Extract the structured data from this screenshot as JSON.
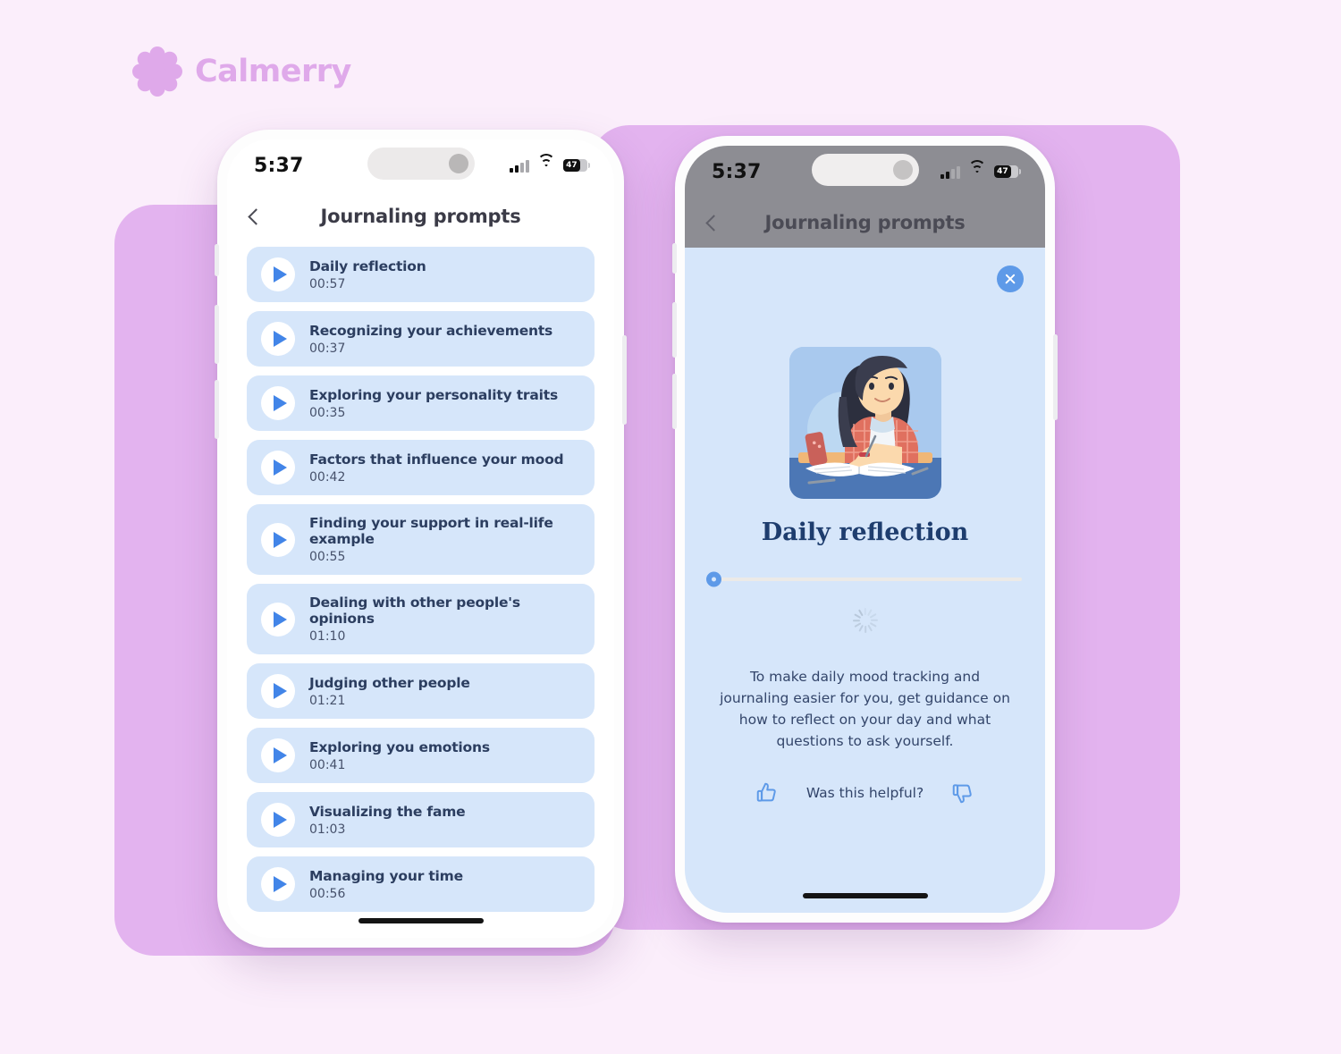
{
  "brand": {
    "name": "Calmerry",
    "logo_icon": "flower-icon",
    "color": "#dfa9ea"
  },
  "background": {
    "page_color": "#fbeefb",
    "slab_color": "#e3b3ef"
  },
  "theme": {
    "card_blue": "#d6e6fa",
    "accent_blue": "#4285e8",
    "title_navy": "#1e3d6e"
  },
  "phone_left": {
    "status": {
      "time": "5:37",
      "battery_percent": "47",
      "signal_icon": "cellular-signal-icon",
      "wifi_icon": "wifi-icon",
      "battery_icon": "battery-icon"
    },
    "nav": {
      "back_icon": "chevron-left-icon",
      "title": "Journaling prompts"
    },
    "prompts": [
      {
        "title": "Daily reflection",
        "duration": "00:57",
        "play_icon": "play-icon"
      },
      {
        "title": "Recognizing your achievements",
        "duration": "00:37",
        "play_icon": "play-icon"
      },
      {
        "title": "Exploring your personality traits",
        "duration": "00:35",
        "play_icon": "play-icon"
      },
      {
        "title": "Factors that influence your mood",
        "duration": "00:42",
        "play_icon": "play-icon"
      },
      {
        "title": "Finding your support in real-life example",
        "duration": "00:55",
        "play_icon": "play-icon"
      },
      {
        "title": "Dealing with other people's opinions",
        "duration": "01:10",
        "play_icon": "play-icon"
      },
      {
        "title": "Judging other people",
        "duration": "01:21",
        "play_icon": "play-icon"
      },
      {
        "title": "Exploring you emotions",
        "duration": "00:41",
        "play_icon": "play-icon"
      },
      {
        "title": "Visualizing the fame",
        "duration": "01:03",
        "play_icon": "play-icon"
      },
      {
        "title": "Managing your time",
        "duration": "00:56",
        "play_icon": "play-icon"
      }
    ]
  },
  "phone_right": {
    "status": {
      "time": "5:37",
      "battery_percent": "47",
      "signal_icon": "cellular-signal-icon",
      "wifi_icon": "wifi-icon",
      "battery_icon": "battery-icon"
    },
    "nav": {
      "back_icon": "chevron-left-icon",
      "title": "Journaling prompts"
    },
    "detail": {
      "close_icon": "close-icon",
      "illustration_icon": "woman-journaling-illustration",
      "title": "Daily reflection",
      "progress_percent": 0,
      "loading_icon": "loading-spinner-icon",
      "body": "To make daily mood tracking and journaling easier for you, get guidance on how to reflect on your day and what questions to ask yourself.",
      "feedback": {
        "question": "Was this helpful?",
        "up_icon": "thumbs-up-icon",
        "down_icon": "thumbs-down-icon"
      }
    }
  }
}
